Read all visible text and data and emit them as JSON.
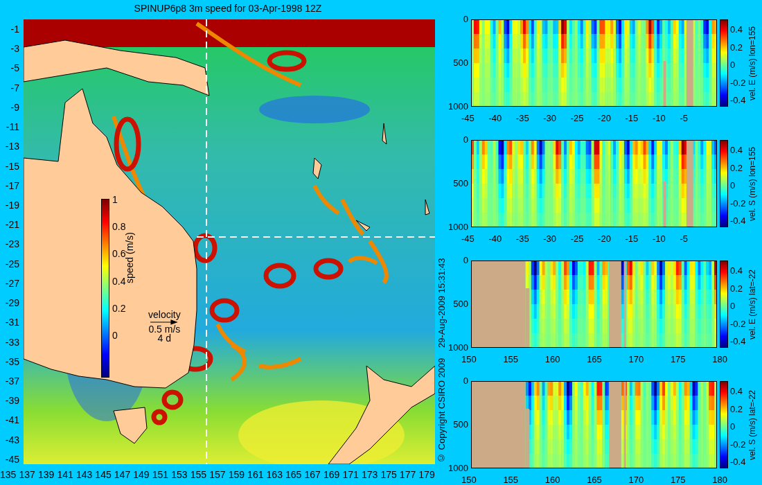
{
  "title": "SPINUP6p8 3m speed for 03-Apr-1998 12Z",
  "map": {
    "y_labels": [
      "-1",
      "-3",
      "-5",
      "-7",
      "-9",
      "-11",
      "-13",
      "-15",
      "-17",
      "-19",
      "-21",
      "-23",
      "-25",
      "-27",
      "-29",
      "-31",
      "-33",
      "-35",
      "-37",
      "-39",
      "-41",
      "-43",
      "-45"
    ],
    "x_labels": [
      "135",
      "137",
      "139",
      "141",
      "143",
      "145",
      "147",
      "149",
      "151",
      "153",
      "155",
      "157",
      "159",
      "161",
      "163",
      "165",
      "167",
      "169",
      "171",
      "173",
      "175",
      "177",
      "179"
    ],
    "colorbar": {
      "label": "speed (m/s)",
      "ticks": [
        "1",
        "0.8",
        "0.6",
        "0.4",
        "0.2",
        "0"
      ]
    },
    "velocity_legend": {
      "label": "velocity",
      "speed": "0.5 m/s",
      "duration": "4 d"
    }
  },
  "credits": [
    "© Copyright CSIRO 2009",
    "29-Aug-2009 15:31:43"
  ],
  "sections": [
    {
      "kind": "meridional",
      "y_labels": [
        "0",
        "500",
        "1000"
      ],
      "x_labels": [
        "-45",
        "-40",
        "-35",
        "-30",
        "-25",
        "-20",
        "-15",
        "-10",
        "-5"
      ],
      "colorbar": {
        "label": "vel. E (m/s) lon=155",
        "ticks": [
          "0.4",
          "0.2",
          "0",
          "-0.2",
          "-0.4"
        ]
      }
    },
    {
      "kind": "meridional",
      "y_labels": [
        "0",
        "500",
        "1000"
      ],
      "x_labels": [
        "-45",
        "-40",
        "-35",
        "-30",
        "-25",
        "-20",
        "-15",
        "-10",
        "-5"
      ],
      "colorbar": {
        "label": "vel. S (m/s) lon=155",
        "ticks": [
          "0.4",
          "0.2",
          "0",
          "-0.2",
          "-0.4"
        ]
      }
    },
    {
      "kind": "zonal",
      "y_labels": [
        "0",
        "500",
        "1000"
      ],
      "x_labels": [
        "150",
        "155",
        "160",
        "165",
        "170",
        "175",
        "180"
      ],
      "colorbar": {
        "label": "vel. E (m/s) lat=-22",
        "ticks": [
          "0.4",
          "0.2",
          "0",
          "-0.2",
          "-0.4"
        ]
      }
    },
    {
      "kind": "zonal",
      "y_labels": [
        "0",
        "500",
        "1000"
      ],
      "x_labels": [
        "150",
        "155",
        "160",
        "165",
        "170",
        "175",
        "180"
      ],
      "colorbar": {
        "label": "vel. S (m/s) lat=-22",
        "ticks": [
          "0.4",
          "0.2",
          "0",
          "-0.2",
          "-0.4"
        ]
      }
    }
  ]
}
